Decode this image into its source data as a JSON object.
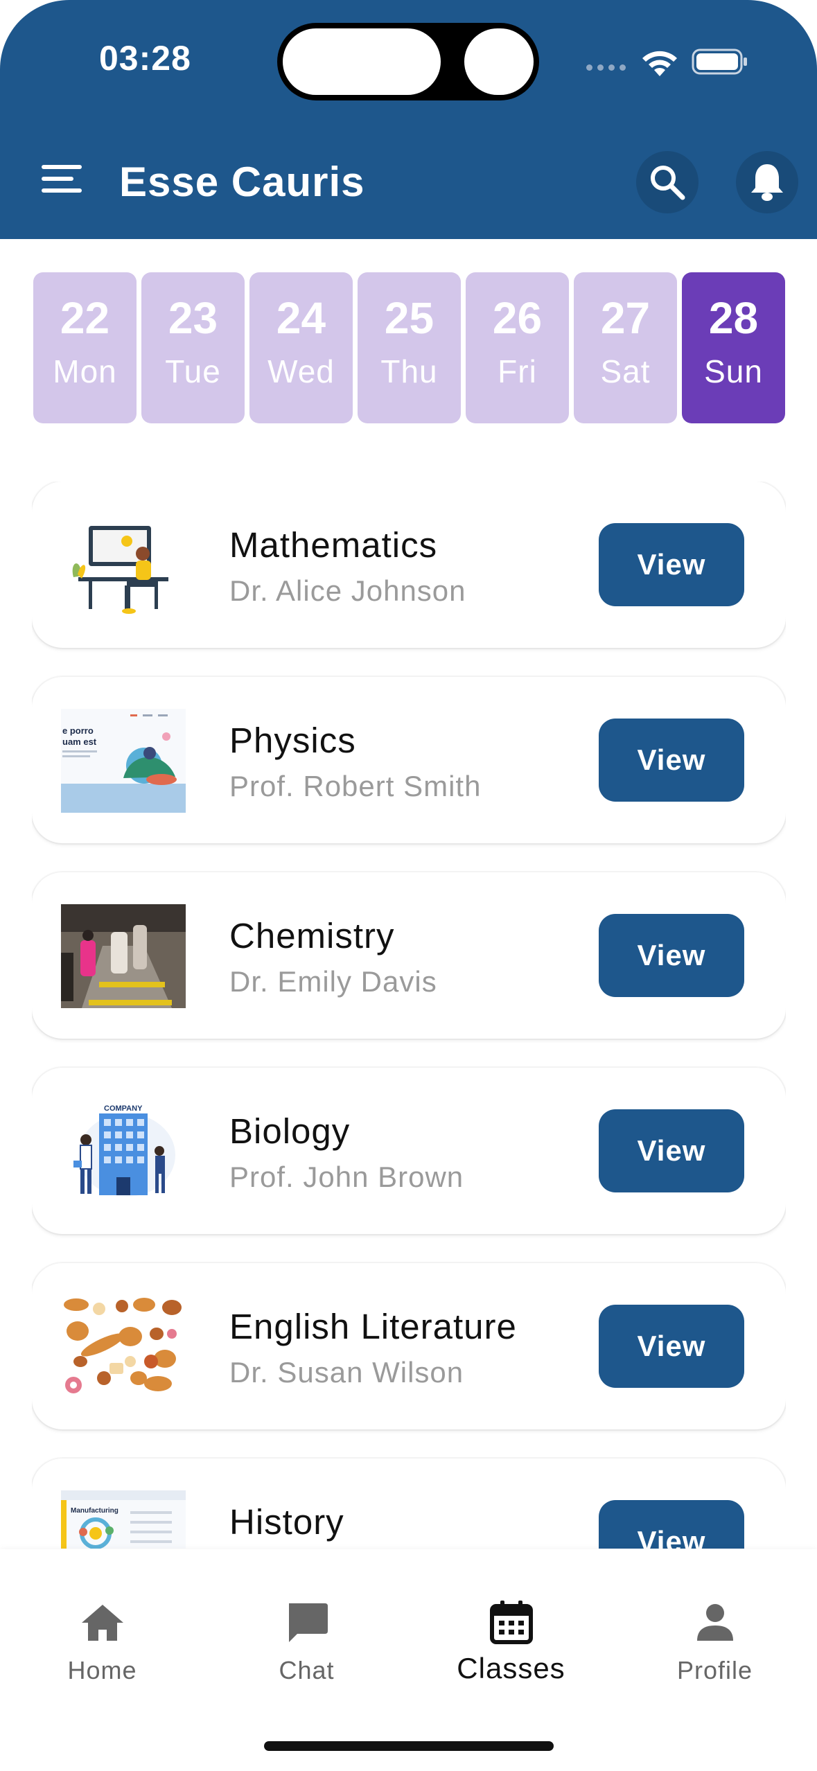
{
  "status_bar": {
    "time": "03:28"
  },
  "header": {
    "title": "Esse Cauris"
  },
  "dates": [
    {
      "num": "22",
      "day": "Mon"
    },
    {
      "num": "23",
      "day": "Tue"
    },
    {
      "num": "24",
      "day": "Wed"
    },
    {
      "num": "25",
      "day": "Thu"
    },
    {
      "num": "26",
      "day": "Fri"
    },
    {
      "num": "27",
      "day": "Sat"
    },
    {
      "num": "28",
      "day": "Sun"
    }
  ],
  "selected_date_index": 6,
  "classes": [
    {
      "name": "Mathematics",
      "teacher": "Dr. Alice Johnson",
      "button": "View"
    },
    {
      "name": "Physics",
      "teacher": "Prof. Robert Smith",
      "button": "View"
    },
    {
      "name": "Chemistry",
      "teacher": "Dr. Emily Davis",
      "button": "View"
    },
    {
      "name": "Biology",
      "teacher": "Prof. John Brown",
      "button": "View"
    },
    {
      "name": "English Literature",
      "teacher": "Dr. Susan Wilson",
      "button": "View"
    },
    {
      "name": "History",
      "teacher": "",
      "button": "View"
    }
  ],
  "thumb_text": {
    "physics_line1": "e porro",
    "physics_line2": "uam est",
    "biology": "COMPANY",
    "history": "Manufacturing"
  },
  "nav": [
    {
      "label": "Home",
      "icon": "home-icon"
    },
    {
      "label": "Chat",
      "icon": "chat-icon"
    },
    {
      "label": "Classes",
      "icon": "calendar-icon"
    },
    {
      "label": "Profile",
      "icon": "person-icon"
    }
  ],
  "active_nav": "Classes",
  "colors": {
    "header": "#1e578c",
    "date_inactive": "#d3c6ea",
    "date_active": "#6b3db7",
    "button": "#1e578c"
  }
}
